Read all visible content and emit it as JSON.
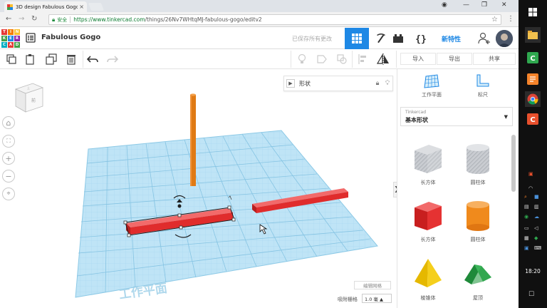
{
  "browser": {
    "tab_title": "3D design Fabulous Gogo",
    "tab_close": "×",
    "secure_label": "安全",
    "url_host": "https://www.tinkercad.com",
    "url_path": "/things/26Nv7WHtqMJ-fabulous-gogo/editv2"
  },
  "header": {
    "logo_letters": [
      "T",
      "I",
      "N",
      "K",
      "E",
      "R",
      "C",
      "A",
      "D"
    ],
    "logo_colors": [
      "#e53935",
      "#f57c00",
      "#fbc02d",
      "#43a047",
      "#1e88e5",
      "#8e24aa",
      "#00acc1",
      "#e53935",
      "#43a047"
    ],
    "design_title": "Fabulous Gogo",
    "saved_status": "已保存所有更改",
    "new_features": "新特性",
    "accent_color": "#1e88e5"
  },
  "toolbar": {
    "import_label": "导入",
    "export_label": "导出",
    "share_label": "共享"
  },
  "viewport": {
    "shape_panel_label": "形状",
    "viewcube_face": "前",
    "workplane_label": "工作平面",
    "edit_grid_label": "编辑网格",
    "snap_label": "吸附栅格",
    "snap_value": "1.0 毫 ▲",
    "panel_toggle": "❯"
  },
  "right_panel": {
    "workplane_tool": "工作平面",
    "ruler_tool": "标尺",
    "category_source": "Tinkercad",
    "category_name": "基本形状",
    "shapes": [
      {
        "label": "长方体",
        "icon": "box-hole-icon"
      },
      {
        "label": "圆柱体",
        "icon": "cylinder-hole-icon"
      },
      {
        "label": "长方体",
        "icon": "box-icon"
      },
      {
        "label": "圆柱体",
        "icon": "cylinder-icon"
      },
      {
        "label": "棱锥体",
        "icon": "pyramid-icon"
      },
      {
        "label": "屋顶",
        "icon": "roof-icon"
      }
    ]
  },
  "taskbar": {
    "clock": "18:20"
  }
}
